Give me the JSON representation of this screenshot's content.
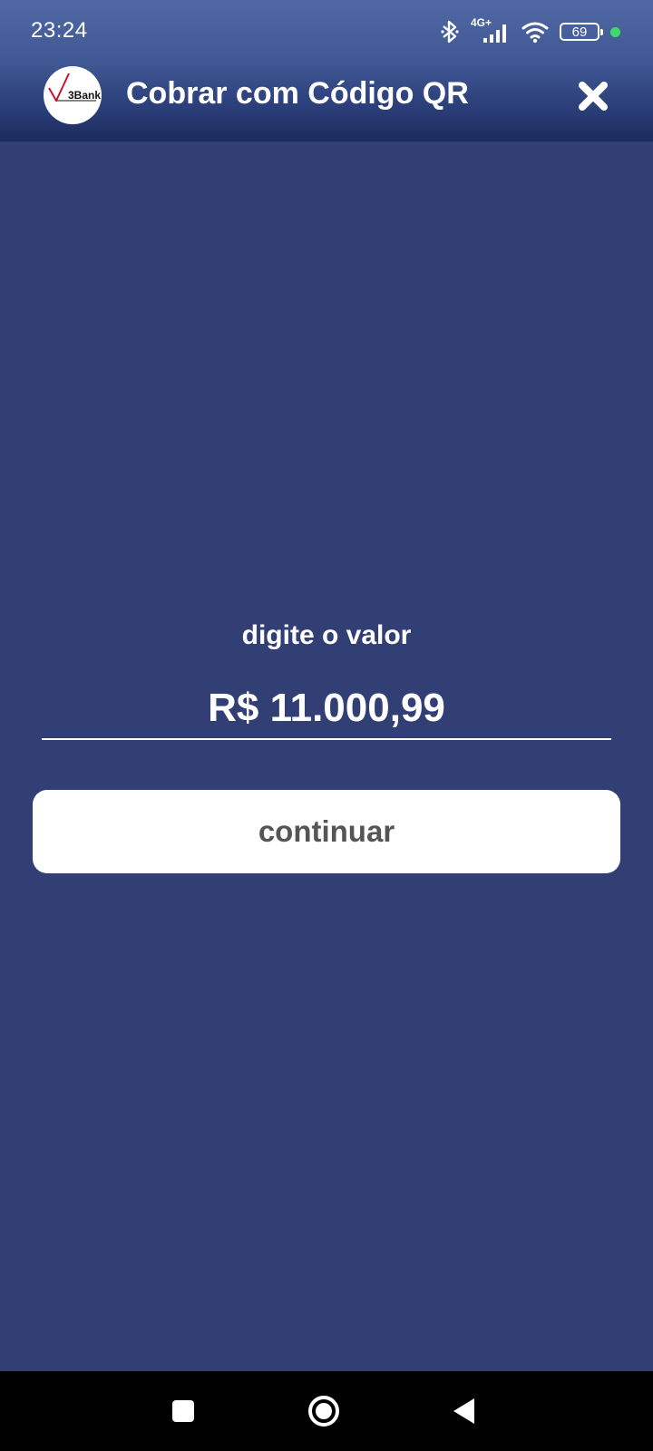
{
  "status_bar": {
    "time": "23:24",
    "network_type": "4G+",
    "battery_level": "69",
    "icons": [
      "bluetooth-icon",
      "cell-signal-icon",
      "wifi-icon",
      "battery-icon",
      "privacy-dot-icon"
    ],
    "privacy_dot_color": "#3ddc6a"
  },
  "app_bar": {
    "logo_text": "3Bank",
    "title": "Cobrar com Código QR",
    "close_icon": "close-icon"
  },
  "form": {
    "prompt": "digite o valor",
    "amount_value": "R$ 11.000,99",
    "continue_label": "continuar"
  },
  "nav_bar": {
    "buttons": [
      "recents-icon",
      "home-icon",
      "back-icon"
    ]
  },
  "colors": {
    "background": "#323f75",
    "header_top": "#5068a3",
    "header_bottom": "#1d2b5c",
    "button_bg": "#ffffff",
    "button_text": "#555555",
    "logo_check": "#c8102e"
  }
}
